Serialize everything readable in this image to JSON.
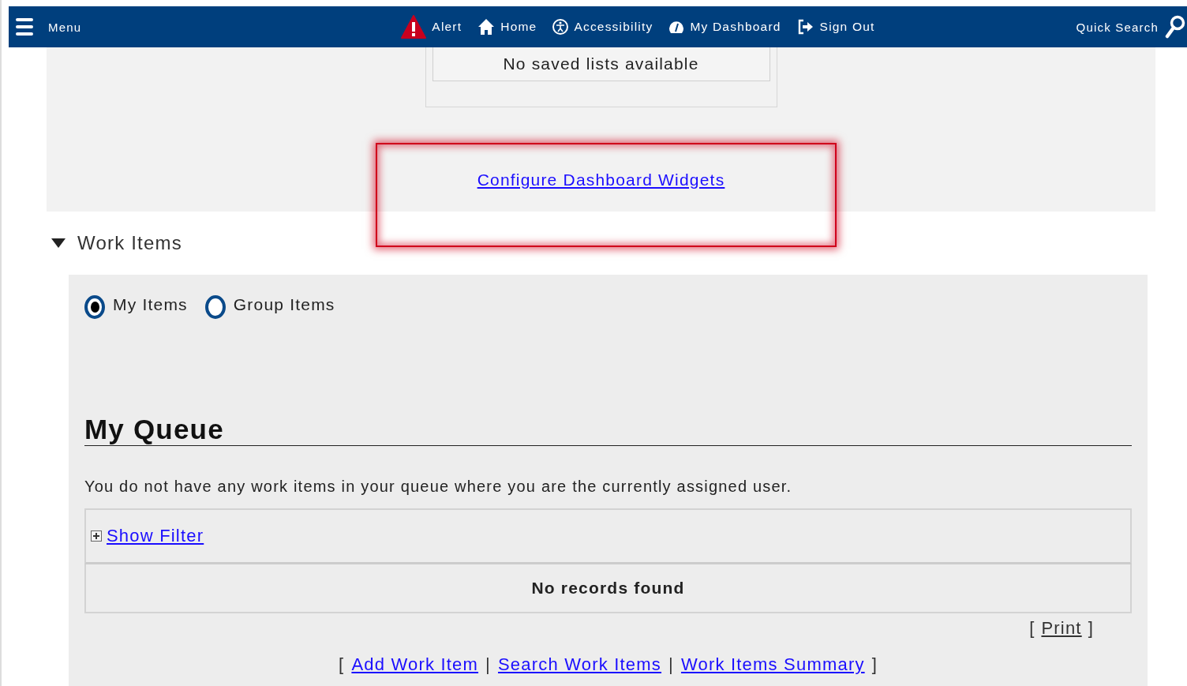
{
  "navbar": {
    "menu_label": "Menu",
    "items": [
      {
        "kind": "alert",
        "label": "Alert"
      },
      {
        "kind": "home",
        "label": "Home"
      },
      {
        "kind": "accessibility",
        "label": "Accessibility"
      },
      {
        "kind": "dashboard",
        "label": "My Dashboard"
      },
      {
        "kind": "signout",
        "label": "Sign Out"
      }
    ],
    "quick_search": "Quick Search"
  },
  "dashboard_panel": {
    "saved_lists": "No saved lists available",
    "configure_link": "Configure Dashboard Widgets",
    "highlighted": true
  },
  "work_items": {
    "title": "Work Items",
    "expanded": true,
    "radios": [
      {
        "label": "My Items",
        "selected": true
      },
      {
        "label": "Group Items",
        "selected": false
      }
    ],
    "queue_title": "My Queue",
    "message": "You do not have any work items in your queue where you are the currently assigned user.",
    "show_filter": "Show Filter",
    "filter_expanded": false,
    "empty": "No records found",
    "print": "Print",
    "print_brackets": [
      "[",
      "]"
    ],
    "links_brackets": [
      "[",
      "]"
    ],
    "separators": [
      "|",
      "|"
    ],
    "links": [
      "Add Work Item",
      "Search Work Items",
      "Work Items Summary"
    ]
  }
}
